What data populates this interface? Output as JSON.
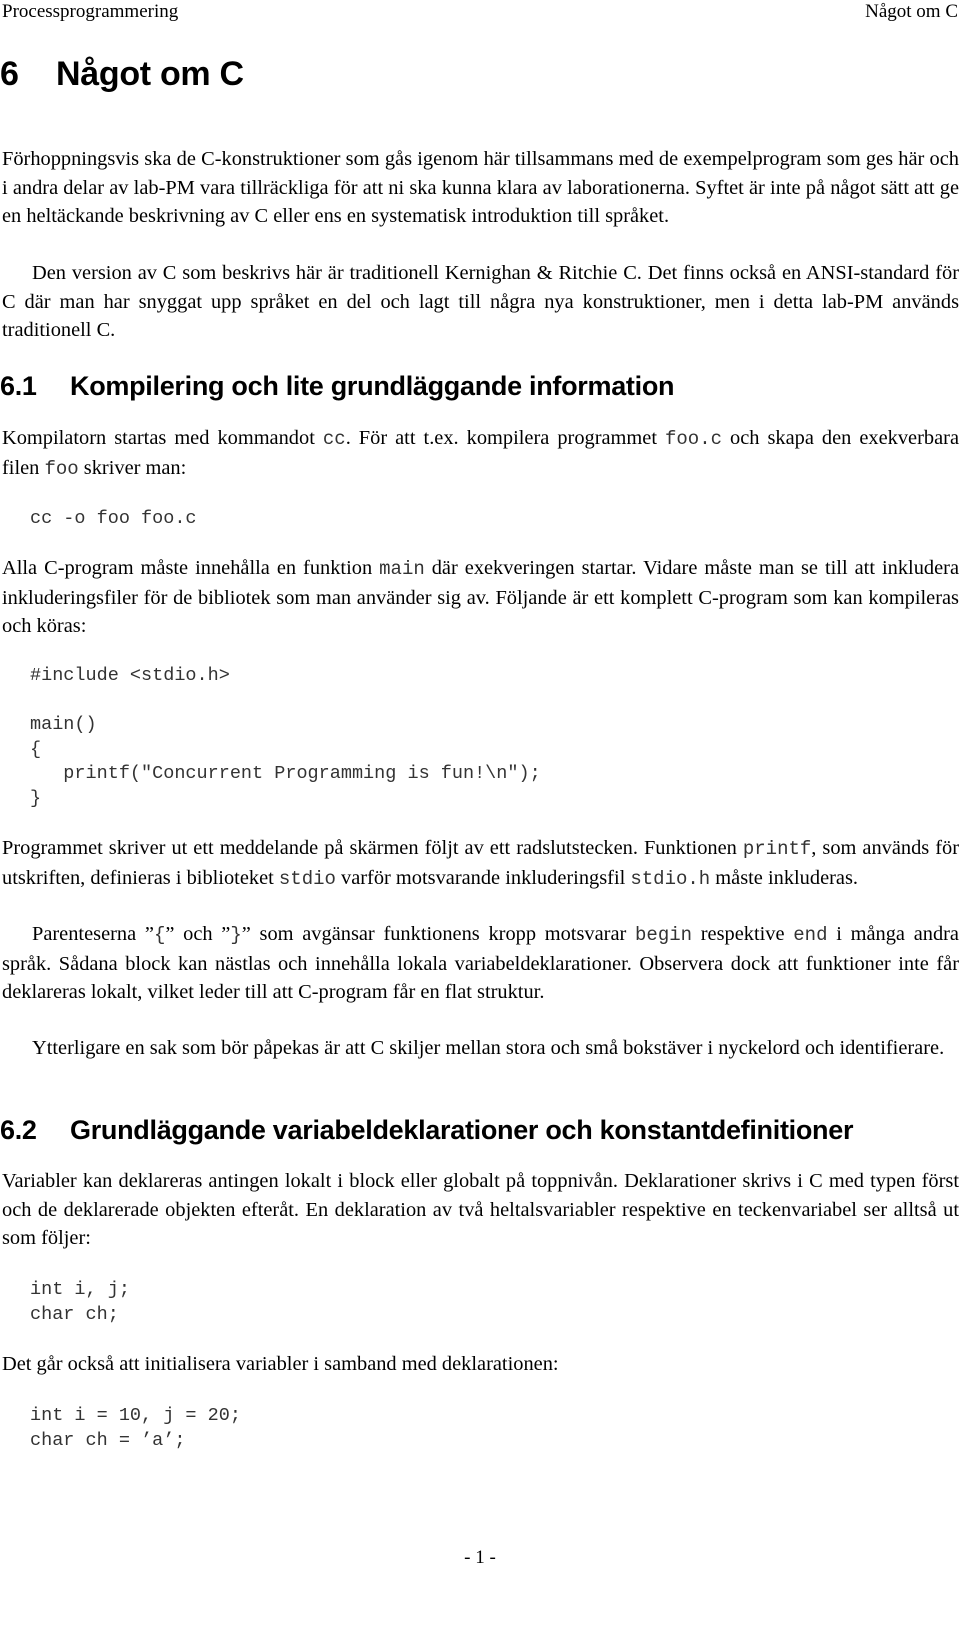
{
  "header": {
    "left": "Processprogrammering",
    "right": "Något om C"
  },
  "chapter": {
    "number": "6",
    "title": "Något om C"
  },
  "intro": {
    "p1": "Förhoppningsvis ska de C-konstruktioner som gås igenom här tillsammans med de exempelprogram som ges här och i andra delar av lab-PM vara tillräckliga för att ni ska kunna klara av laborationerna. Syftet är inte på något sätt att ge en heltäckande beskrivning av C eller ens en systematisk introduktion till språket.",
    "p2": "Den version av C som beskrivs här är traditionell Kernighan & Ritchie C. Det finns också en ANSI-standard för C där man har snyggat upp språket en del och lagt till några nya konstruktioner, men i detta lab-PM används traditionell C."
  },
  "section_6_1": {
    "number": "6.1",
    "title": "Kompilering och lite grundläggande information",
    "p1": {
      "t1": "Kompilatorn startas med kommandot ",
      "c1": "cc",
      "t2": ". För att t.ex. kompilera programmet ",
      "c2": "foo.c",
      "t3": " och skapa den exekverbara filen ",
      "c3": "foo",
      "t4": " skriver man:"
    },
    "code1": "cc -o foo foo.c",
    "p2": {
      "t1": "Alla C-program måste innehålla en funktion ",
      "c1": "main",
      "t2": " där exekveringen startar. Vidare måste man se till att inkludera inkluderingsfiler för de bibliotek som man använder sig av. Följande är ett komplett C-program som kan kompileras och köras:"
    },
    "code2": "#include <stdio.h>\n\nmain()\n{\n   printf(\"Concurrent Programming is fun!\\n\");\n}",
    "p3": {
      "t1": "Programmet skriver ut ett meddelande på skärmen följt av ett radslutstecken. Funktionen ",
      "c1": "printf",
      "t2": ", som används för utskriften, definieras i biblioteket ",
      "c2": "stdio",
      "t3": " varför motsvarande inkluderingsfil ",
      "c3": "stdio.h",
      "t4": " måste inkluderas."
    },
    "p4": {
      "t1": "Parenteserna ”",
      "c1": "{",
      "t2": "” och ”",
      "c2": "}",
      "t3": "” som avgänsar funktionens kropp motsvarar ",
      "c3": "begin",
      "t4": " respektive ",
      "c4": "end",
      "t5": " i många andra språk. Sådana block kan nästlas och innehålla lokala variabeldeklarationer. Observera dock att funktioner inte får deklareras lokalt, vilket leder till att C-program får en flat struktur."
    },
    "p5": "Ytterligare en sak som bör påpekas är att C skiljer mellan stora och små bokstäver i nyckelord och identifierare."
  },
  "section_6_2": {
    "number": "6.2",
    "title": "Grundläggande variabeldeklarationer och konstantdefinitioner",
    "p1": "Variabler kan deklareras antingen lokalt i block eller globalt på toppnivån. Deklarationer skrivs i C med typen först och de deklarerade objekten efteråt. En deklaration av två heltalsvariabler respektive en teckenvariabel ser alltså ut som följer:",
    "code1": "int i, j;\nchar ch;",
    "p2": "Det går också att initialisera variabler i samband med deklarationen:",
    "code2": "int i = 10, j = 20;\nchar ch = ’a’;"
  },
  "footer": {
    "page_number": "- 1 -"
  }
}
